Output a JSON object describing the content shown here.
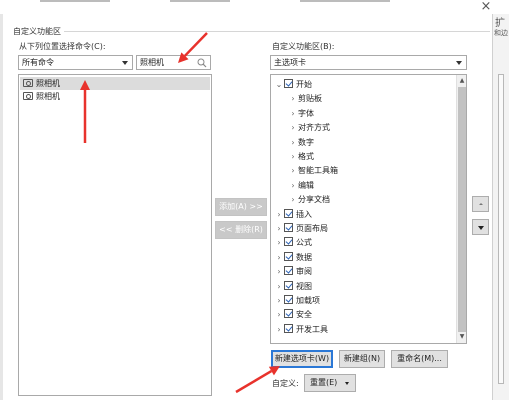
{
  "dialog": {
    "close_glyph": "×",
    "group_title": "自定义功能区"
  },
  "left": {
    "choose_label": "从下列位置选择命令(C):",
    "category_value": "所有命令",
    "search_value": "照相机",
    "items": [
      "照相机",
      "照相机"
    ]
  },
  "middle": {
    "add_label": "添加(A) >>",
    "remove_label": "<< 删除(R)"
  },
  "right": {
    "customize_label": "自定义功能区(B):",
    "tabs_value": "主选项卡",
    "tree": [
      {
        "label": "开始",
        "level": 0,
        "expanded": true,
        "checkbox": true,
        "checked": true
      },
      {
        "label": "剪贴板",
        "level": 1,
        "expanded": false,
        "checkbox": false,
        "checked": false
      },
      {
        "label": "字体",
        "level": 1,
        "expanded": false,
        "checkbox": false,
        "checked": false
      },
      {
        "label": "对齐方式",
        "level": 1,
        "expanded": false,
        "checkbox": false,
        "checked": false
      },
      {
        "label": "数字",
        "level": 1,
        "expanded": false,
        "checkbox": false,
        "checked": false
      },
      {
        "label": "格式",
        "level": 1,
        "expanded": false,
        "checkbox": false,
        "checked": false
      },
      {
        "label": "智能工具箱",
        "level": 1,
        "expanded": false,
        "checkbox": false,
        "checked": false
      },
      {
        "label": "编辑",
        "level": 1,
        "expanded": false,
        "checkbox": false,
        "checked": false
      },
      {
        "label": "分享文档",
        "level": 1,
        "expanded": false,
        "checkbox": false,
        "checked": false
      },
      {
        "label": "插入",
        "level": 0,
        "expanded": false,
        "checkbox": true,
        "checked": true
      },
      {
        "label": "页面布局",
        "level": 0,
        "expanded": false,
        "checkbox": true,
        "checked": true
      },
      {
        "label": "公式",
        "level": 0,
        "expanded": false,
        "checkbox": true,
        "checked": true
      },
      {
        "label": "数据",
        "level": 0,
        "expanded": false,
        "checkbox": true,
        "checked": true
      },
      {
        "label": "审阅",
        "level": 0,
        "expanded": false,
        "checkbox": true,
        "checked": true
      },
      {
        "label": "视图",
        "level": 0,
        "expanded": false,
        "checkbox": true,
        "checked": true
      },
      {
        "label": "加载项",
        "level": 0,
        "expanded": false,
        "checkbox": true,
        "checked": true
      },
      {
        "label": "安全",
        "level": 0,
        "expanded": false,
        "checkbox": true,
        "checked": true
      },
      {
        "label": "开发工具",
        "level": 0,
        "expanded": false,
        "checkbox": true,
        "checked": true
      }
    ],
    "new_tab_label": "新建选项卡(W)",
    "new_group_label": "新建组(N)",
    "rename_label": "重命名(M)...",
    "customize_prefix": "自定义:",
    "reset_label": "重置(E)",
    "right_edge_glyph": "扩",
    "right_edge_glyph2": "和边"
  },
  "colors": {
    "annotation_arrow": "#e8322c",
    "focus_border": "#2b78d6"
  }
}
